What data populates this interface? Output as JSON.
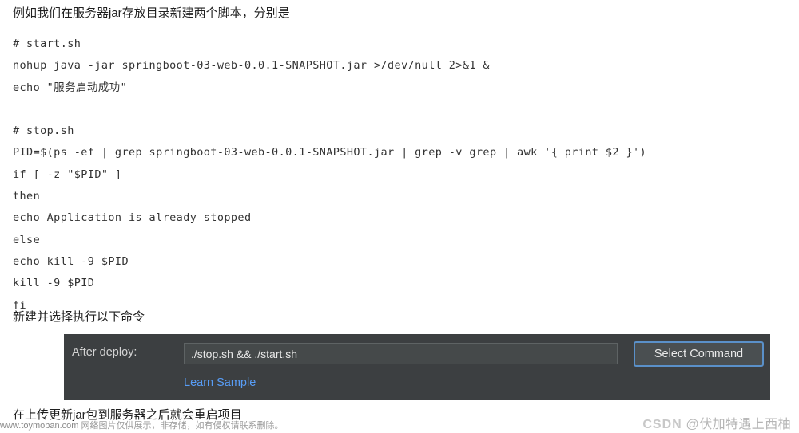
{
  "document": {
    "intro_paragraph": "例如我们在服务器jar存放目录新建两个脚本，分别是",
    "mid_paragraph": "新建并选择执行以下命令",
    "bottom_paragraph": "在上传更新jar包到服务器之后就会重启项目",
    "code_lines": [
      "# start.sh",
      "nohup java -jar springboot-03-web-0.0.1-SNAPSHOT.jar >/dev/null 2>&1 &",
      "echo \"服务启动成功\"",
      "",
      "# stop.sh",
      "PID=$(ps -ef | grep springboot-03-web-0.0.1-SNAPSHOT.jar | grep -v grep | awk '{ print $2 }')",
      "if [ -z \"$PID\" ]",
      "then",
      "echo Application is already stopped",
      "else",
      "echo kill -9 $PID",
      "kill -9 $PID",
      "fi"
    ]
  },
  "deploy_panel": {
    "label": "After deploy:",
    "command_value": "./stop.sh && ./start.sh",
    "command_placeholder": "",
    "learn_link": "Learn Sample",
    "select_button": "Select Command",
    "colors": {
      "panel_bg": "#3c3f41",
      "input_bg": "#45494a",
      "link": "#589df6",
      "button_border": "#5a90c9"
    }
  },
  "watermarks": {
    "left": "网络图片仅供展示，非存储，如有侵权请联系删除。",
    "left_domain": "www.toymoban.com",
    "right_brand": "CSDN",
    "right_author": "@伏加特遇上西柚"
  }
}
